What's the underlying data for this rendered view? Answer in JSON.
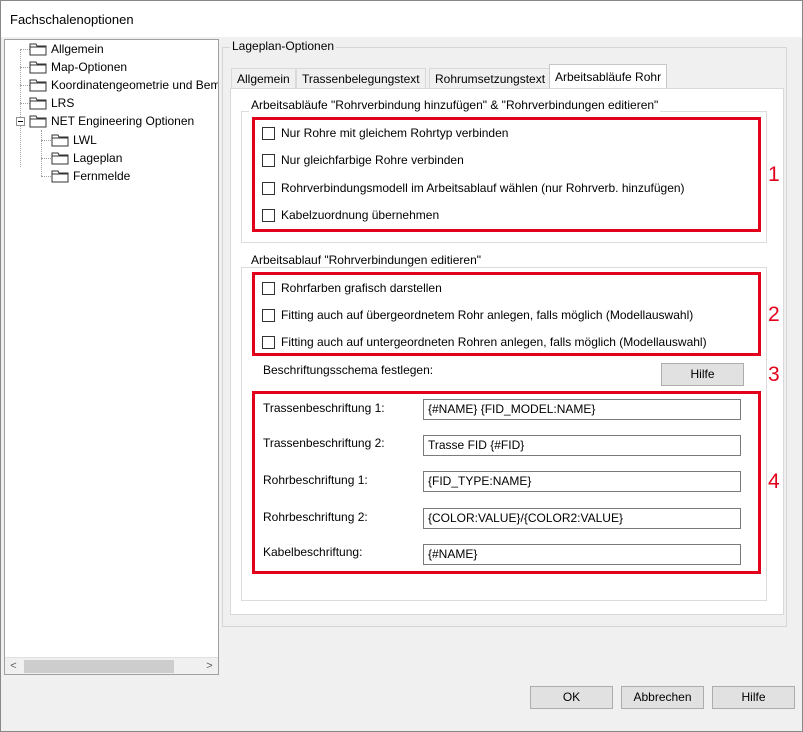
{
  "window": {
    "title": "Fachschalenoptionen"
  },
  "tree": {
    "items": [
      {
        "label": "Allgemein"
      },
      {
        "label": "Map-Optionen"
      },
      {
        "label": "Koordinatengeometrie und Bem"
      },
      {
        "label": "LRS"
      },
      {
        "label": "NET Engineering Optionen"
      },
      {
        "label": "LWL"
      },
      {
        "label": "Lageplan"
      },
      {
        "label": "Fernmelde"
      }
    ],
    "scroll_left": "<",
    "scroll_right": ">"
  },
  "panel": {
    "group_title": "Lageplan-Optionen",
    "tabs": [
      {
        "label": "Allgemein"
      },
      {
        "label": "Trassenbelegungstext"
      },
      {
        "label": "Rohrumsetzungstext"
      },
      {
        "label": "Arbeitsabläufe Rohr"
      }
    ],
    "active_tab": "Arbeitsabläufe Rohr",
    "group1": {
      "title": "Arbeitsabläufe \"Rohrverbindung hinzufügen\" & \"Rohrverbindungen editieren\"",
      "checkboxes": [
        {
          "label": "Nur Rohre mit gleichem Rohrtyp verbinden",
          "checked": false
        },
        {
          "label": "Nur gleichfarbige Rohre verbinden",
          "checked": false
        },
        {
          "label": "Rohrverbindungsmodell im Arbeitsablauf wählen (nur Rohrverb. hinzufügen)",
          "checked": false
        },
        {
          "label": "Kabelzuordnung übernehmen",
          "checked": false
        }
      ]
    },
    "group2": {
      "title": "Arbeitsablauf \"Rohrverbindungen editieren\"",
      "checkboxes": [
        {
          "label": "Rohrfarben grafisch darstellen",
          "checked": false
        },
        {
          "label": "Fitting auch auf übergeordnetem Rohr anlegen, falls möglich (Modellauswahl)",
          "checked": false
        },
        {
          "label": "Fitting auch auf untergeordneten Rohren anlegen, falls möglich (Modellauswahl)",
          "checked": false
        }
      ],
      "schema_label": "Beschriftungsschema festlegen:",
      "help_button": "Hilfe",
      "fields": [
        {
          "label": "Trassenbeschriftung 1:",
          "value": "{#NAME} {FID_MODEL:NAME}"
        },
        {
          "label": "Trassenbeschriftung 2:",
          "value": "Trasse FID {#FID}"
        },
        {
          "label": "Rohrbeschriftung 1:",
          "value": "{FID_TYPE:NAME}"
        },
        {
          "label": "Rohrbeschriftung 2:",
          "value": "{COLOR:VALUE}/{COLOR2:VALUE}"
        },
        {
          "label": "Kabelbeschriftung:",
          "value": "{#NAME}"
        }
      ]
    }
  },
  "annotations": {
    "marker_1": "1",
    "marker_2": "2",
    "marker_3": "3",
    "marker_4": "4",
    "color": "#e3001b"
  },
  "footer": {
    "ok": "OK",
    "cancel": "Abbrechen",
    "help": "Hilfe"
  }
}
